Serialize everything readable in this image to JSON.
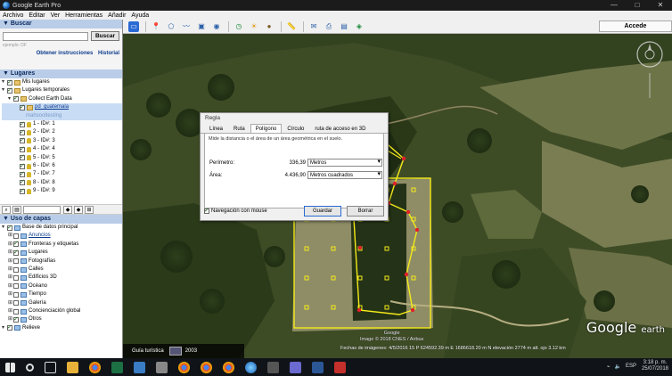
{
  "window": {
    "title": "Google Earth Pro",
    "controls": [
      "—",
      "□",
      "✕"
    ]
  },
  "menu": [
    "Archivo",
    "Editar",
    "Ver",
    "Herramientas",
    "Añadir",
    "Ayuda"
  ],
  "search": {
    "header": "▼ Buscar",
    "placeholder": "",
    "button": "Buscar",
    "example": "ejemplo: DF",
    "link_directions": "Obtener instrucciones",
    "link_history": "Historial"
  },
  "places": {
    "header": "▼ Lugares",
    "items": [
      {
        "label": "Mis lugares",
        "depth": 0,
        "checked": true,
        "icon": "folder-icon"
      },
      {
        "label": "Lugares temporales",
        "depth": 0,
        "checked": true,
        "icon": "folder-icon"
      },
      {
        "label": "Collect Earth Data",
        "depth": 1,
        "checked": true,
        "icon": "folder-icon"
      },
      {
        "label": "pd_guatemala",
        "depth": 2,
        "checked": true,
        "icon": "folder-icon",
        "link": true
      },
      {
        "label": "mahsooltesting",
        "depth": 3,
        "checked": false,
        "icon": "",
        "faded": true
      },
      {
        "label": "1 - ID#: 1",
        "depth": 2,
        "checked": true,
        "icon": "pin-icon"
      },
      {
        "label": "2 - ID#: 2",
        "depth": 2,
        "checked": true,
        "icon": "pin-icon"
      },
      {
        "label": "3 - ID#: 3",
        "depth": 2,
        "checked": true,
        "icon": "pin-icon"
      },
      {
        "label": "4 - ID#: 4",
        "depth": 2,
        "checked": true,
        "icon": "pin-icon"
      },
      {
        "label": "5 - ID#: 5",
        "depth": 2,
        "checked": true,
        "icon": "pin-icon"
      },
      {
        "label": "6 - ID#: 6",
        "depth": 2,
        "checked": true,
        "icon": "pin-icon"
      },
      {
        "label": "7 - ID#: 7",
        "depth": 2,
        "checked": true,
        "icon": "pin-icon"
      },
      {
        "label": "8 - ID#: 8",
        "depth": 2,
        "checked": true,
        "icon": "pin-icon"
      },
      {
        "label": "9 - ID#: 9",
        "depth": 2,
        "checked": true,
        "icon": "pin-icon"
      }
    ]
  },
  "layers": {
    "header": "▼ Uso de capas",
    "items": [
      {
        "label": "Base de datos principal",
        "depth": 0,
        "checked": true
      },
      {
        "label": "Anuncios",
        "depth": 1,
        "checked": false,
        "link": true
      },
      {
        "label": "Fronteras y etiquetas",
        "depth": 1,
        "checked": true
      },
      {
        "label": "Lugares",
        "depth": 1,
        "checked": true
      },
      {
        "label": "Fotografías",
        "depth": 1,
        "checked": false
      },
      {
        "label": "Calles",
        "depth": 1,
        "checked": false
      },
      {
        "label": "Edificios 3D",
        "depth": 1,
        "checked": false
      },
      {
        "label": "Océano",
        "depth": 1,
        "checked": false
      },
      {
        "label": "Tiempo",
        "depth": 1,
        "checked": false
      },
      {
        "label": "Galería",
        "depth": 1,
        "checked": false
      },
      {
        "label": "Concienciación global",
        "depth": 1,
        "checked": false
      },
      {
        "label": "Otros",
        "depth": 1,
        "checked": true
      },
      {
        "label": "Relieve",
        "depth": 0,
        "checked": true
      }
    ]
  },
  "toolbar": {
    "accede": "Accede"
  },
  "ruler": {
    "title": "Regla",
    "tabs": [
      "Línea",
      "Ruta",
      "Polígono",
      "Círculo",
      "ruta de acceso en 3D"
    ],
    "active_tab": "Polígono",
    "description": "Mide la distancia o el área de un área geométrica en el suelo.",
    "perimeter_label": "Perímetro:",
    "perimeter_value": "336,39",
    "perimeter_unit": "Metros",
    "area_label": "Área:",
    "area_value": "4.436,90",
    "area_unit": "Metros cuadrados",
    "nav_label": "Navegación con mouse",
    "nav_checked": true,
    "save": "Guardar",
    "clear": "Borrar"
  },
  "map": {
    "logo_main": "Google",
    "logo_sub": "earth",
    "copyright_1": "Google",
    "copyright_2": "Image © 2018 CNES / Airbus",
    "status": "Fechas de imágenes: 4/5/2016     15 P 624592.39 m E 1686618.20 m N   elevación  2774 m        alt. ojo   3.12 km",
    "tour_label": "Guía turística",
    "tour_thumb": "2003"
  },
  "taskbar": {
    "lang": "ESP",
    "time": "3:18 p. m.",
    "date": "25/07/2018"
  },
  "colors": {
    "yellow": "#f4ea1a",
    "red": "#e0202a",
    "sidebar_header": "#b9cde8"
  }
}
